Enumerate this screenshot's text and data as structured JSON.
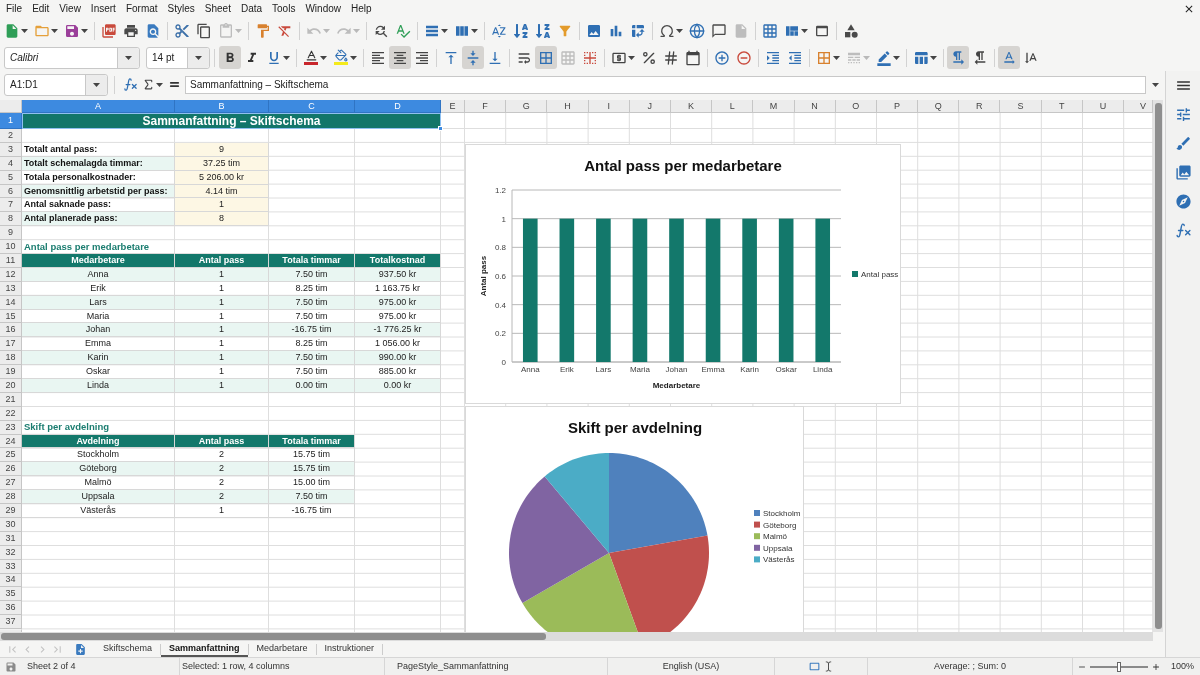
{
  "menu": [
    "File",
    "Edit",
    "View",
    "Insert",
    "Format",
    "Styles",
    "Sheet",
    "Data",
    "Tools",
    "Window",
    "Help"
  ],
  "standard_toolbar": [
    [
      {
        "kind": "new",
        "disabled": false
      },
      {
        "kind": "open",
        "disabled": false
      },
      {
        "kind": "save",
        "disabled": false
      }
    ],
    [
      {
        "kind": "export_pdf",
        "disabled": false
      },
      {
        "kind": "print",
        "disabled": false
      },
      {
        "kind": "print_preview",
        "disabled": false
      }
    ],
    [
      {
        "kind": "cut",
        "disabled": false
      },
      {
        "kind": "copy",
        "disabled": false
      },
      {
        "kind": "paste",
        "disabled": true
      }
    ],
    [
      {
        "kind": "clone_formatting",
        "disabled": false
      },
      {
        "kind": "clear_formatting",
        "disabled": false
      }
    ],
    [
      {
        "kind": "undo",
        "disabled": true
      },
      {
        "kind": "redo",
        "disabled": true
      }
    ],
    [
      {
        "kind": "find_replace",
        "disabled": false
      },
      {
        "kind": "spelling",
        "disabled": false
      }
    ],
    [
      {
        "kind": "row",
        "disabled": false
      },
      {
        "kind": "column",
        "disabled": false
      }
    ],
    [
      {
        "kind": "sort",
        "disabled": false
      },
      {
        "kind": "sort_ascending",
        "disabled": false
      },
      {
        "kind": "sort_descending",
        "disabled": false
      },
      {
        "kind": "autofilter",
        "disabled": false
      }
    ],
    [
      {
        "kind": "image",
        "disabled": false
      },
      {
        "kind": "chart",
        "disabled": false
      },
      {
        "kind": "pivot_table",
        "disabled": false
      }
    ],
    [
      {
        "kind": "special_character",
        "disabled": false
      },
      {
        "kind": "hyperlink",
        "disabled": false
      },
      {
        "kind": "comment",
        "disabled": false
      },
      {
        "kind": "header_footer",
        "disabled": true
      }
    ],
    [
      {
        "kind": "print_area",
        "disabled": false
      },
      {
        "kind": "freeze",
        "disabled": false
      },
      {
        "kind": "split_window",
        "disabled": false
      }
    ],
    [
      {
        "kind": "draw_functions",
        "disabled": false
      }
    ]
  ],
  "format_toolbar": {
    "font": "Calibri",
    "size": "14 pt",
    "groups": [
      [
        {
          "kind": "bold",
          "on": true,
          "disabled": false
        },
        {
          "kind": "italic",
          "on": false,
          "disabled": false
        },
        {
          "kind": "underline",
          "on": false,
          "disabled": false
        }
      ],
      [
        {
          "kind": "font_color",
          "on": false,
          "disabled": false
        },
        {
          "kind": "highlight",
          "on": false,
          "disabled": false
        }
      ],
      [
        {
          "kind": "align_left",
          "on": false,
          "disabled": false
        },
        {
          "kind": "align_center",
          "on": true,
          "disabled": false
        },
        {
          "kind": "align_right",
          "on": false,
          "disabled": false
        }
      ],
      [
        {
          "kind": "align_top",
          "on": false,
          "disabled": false
        },
        {
          "kind": "align_middle",
          "on": true,
          "disabled": false
        },
        {
          "kind": "align_bottom",
          "on": false,
          "disabled": false
        }
      ],
      [
        {
          "kind": "wrap_text",
          "on": false,
          "disabled": false
        },
        {
          "kind": "merge_center",
          "on": true,
          "disabled": false
        },
        {
          "kind": "merge",
          "on": false,
          "disabled": true
        },
        {
          "kind": "unmerge",
          "on": false,
          "disabled": false
        }
      ],
      [
        {
          "kind": "currency",
          "on": false,
          "disabled": false
        },
        {
          "kind": "percent",
          "on": false,
          "disabled": false
        },
        {
          "kind": "number",
          "on": false,
          "disabled": false
        },
        {
          "kind": "date",
          "on": false,
          "disabled": false
        }
      ],
      [
        {
          "kind": "add_decimal",
          "on": false,
          "disabled": false
        },
        {
          "kind": "delete_decimal",
          "on": false,
          "disabled": false
        }
      ],
      [
        {
          "kind": "indent_increase",
          "on": false,
          "disabled": false
        },
        {
          "kind": "indent_decrease",
          "on": false,
          "disabled": false
        }
      ],
      [
        {
          "kind": "borders",
          "on": false,
          "disabled": false
        },
        {
          "kind": "border_style",
          "on": false,
          "disabled": true
        },
        {
          "kind": "border_color",
          "on": false,
          "disabled": false
        }
      ],
      [
        {
          "kind": "conditional",
          "on": false,
          "disabled": false
        }
      ],
      [
        {
          "kind": "left_to_right",
          "on": true,
          "disabled": false
        },
        {
          "kind": "right_to_left",
          "on": false,
          "disabled": false
        }
      ],
      [
        {
          "kind": "text_horizontal",
          "on": true,
          "disabled": false
        },
        {
          "kind": "text_vertical",
          "on": false,
          "disabled": false
        }
      ]
    ]
  },
  "formula_bar": {
    "name_box": "A1:D1",
    "content": "Sammanfattning – Skiftschema"
  },
  "sheet": {
    "columns": [
      {
        "label": "A",
        "selected": true
      },
      {
        "label": "B",
        "selected": true
      },
      {
        "label": "C",
        "selected": true
      },
      {
        "label": "D",
        "selected": true
      },
      {
        "label": "E",
        "selected": false
      },
      {
        "label": "F",
        "selected": false
      },
      {
        "label": "G",
        "selected": false
      },
      {
        "label": "H",
        "selected": false
      },
      {
        "label": "I",
        "selected": false
      },
      {
        "label": "J",
        "selected": false
      },
      {
        "label": "K",
        "selected": false
      },
      {
        "label": "L",
        "selected": false
      },
      {
        "label": "M",
        "selected": false
      },
      {
        "label": "N",
        "selected": false
      },
      {
        "label": "O",
        "selected": false
      },
      {
        "label": "P",
        "selected": false
      },
      {
        "label": "Q",
        "selected": false
      },
      {
        "label": "R",
        "selected": false
      },
      {
        "label": "S",
        "selected": false
      },
      {
        "label": "T",
        "selected": false
      },
      {
        "label": "U",
        "selected": false
      },
      {
        "label": "V",
        "selected": false
      }
    ],
    "rows": [
      {
        "label": "1",
        "selected": true
      },
      {
        "label": "2",
        "selected": false
      },
      {
        "label": "3",
        "selected": false
      },
      {
        "label": "4",
        "selected": false
      },
      {
        "label": "5",
        "selected": false
      },
      {
        "label": "6",
        "selected": false
      },
      {
        "label": "7",
        "selected": false
      },
      {
        "label": "8",
        "selected": false
      },
      {
        "label": "9",
        "selected": false
      },
      {
        "label": "10",
        "selected": false
      },
      {
        "label": "11",
        "selected": false
      },
      {
        "label": "12",
        "selected": false
      },
      {
        "label": "13",
        "selected": false
      },
      {
        "label": "14",
        "selected": false
      },
      {
        "label": "15",
        "selected": false
      },
      {
        "label": "16",
        "selected": false
      },
      {
        "label": "17",
        "selected": false
      },
      {
        "label": "18",
        "selected": false
      },
      {
        "label": "19",
        "selected": false
      },
      {
        "label": "20",
        "selected": false
      },
      {
        "label": "21",
        "selected": false
      },
      {
        "label": "22",
        "selected": false
      },
      {
        "label": "23",
        "selected": false
      },
      {
        "label": "24",
        "selected": false
      },
      {
        "label": "25",
        "selected": false
      },
      {
        "label": "26",
        "selected": false
      },
      {
        "label": "27",
        "selected": false
      },
      {
        "label": "28",
        "selected": false
      },
      {
        "label": "29",
        "selected": false
      },
      {
        "label": "30",
        "selected": false
      },
      {
        "label": "31",
        "selected": false
      },
      {
        "label": "32",
        "selected": false
      },
      {
        "label": "33",
        "selected": false
      },
      {
        "label": "34",
        "selected": false
      },
      {
        "label": "35",
        "selected": false
      },
      {
        "label": "36",
        "selected": false
      },
      {
        "label": "37",
        "selected": false
      }
    ],
    "title": "Sammanfattning – Skiftschema",
    "stats": [
      {
        "label": "Totalt antal pass:",
        "value": "9"
      },
      {
        "label": "Totalt schemalagda timmar:",
        "value": "37.25 tim"
      },
      {
        "label": "Totala personalkostnader:",
        "value": "5 206.00 kr"
      },
      {
        "label": "Genomsnittlig arbetstid per pass:",
        "value": "4.14 tim"
      },
      {
        "label": "Antal saknade pass:",
        "value": "1"
      },
      {
        "label": "Antal planerade pass:",
        "value": "8"
      }
    ],
    "employee_table": {
      "heading": "Antal pass per medarbetare",
      "columns": [
        "Medarbetare",
        "Antal pass",
        "Totala timmar",
        "Totalkostnad"
      ],
      "rows": [
        [
          "Anna",
          "1",
          "7.50 tim",
          "937.50 kr"
        ],
        [
          "Erik",
          "1",
          "8.25 tim",
          "1 163.75 kr"
        ],
        [
          "Lars",
          "1",
          "7.50 tim",
          "975.00 kr"
        ],
        [
          "Maria",
          "1",
          "7.50 tim",
          "975.00 kr"
        ],
        [
          "Johan",
          "1",
          "-16.75 tim",
          "-1 776.25 kr"
        ],
        [
          "Emma",
          "1",
          "8.25 tim",
          "1 056.00 kr"
        ],
        [
          "Karin",
          "1",
          "7.50 tim",
          "990.00 kr"
        ],
        [
          "Oskar",
          "1",
          "7.50 tim",
          "885.00 kr"
        ],
        [
          "Linda",
          "1",
          "0.00 tim",
          "0.00 kr"
        ]
      ]
    },
    "department_table": {
      "heading": "Skift per avdelning",
      "columns": [
        "Avdelning",
        "Antal pass",
        "Totala timmar"
      ],
      "rows": [
        [
          "Stockholm",
          "2",
          "15.75 tim"
        ],
        [
          "Göteborg",
          "2",
          "15.75 tim"
        ],
        [
          "Malmö",
          "2",
          "15.00 tim"
        ],
        [
          "Uppsala",
          "2",
          "7.50 tim"
        ],
        [
          "Västerås",
          "1",
          "-16.75 tim"
        ]
      ]
    },
    "charts": [
      {
        "chart_data": {
          "type": "bar",
          "title": "Antal pass per medarbetare",
          "xlabel": "Medarbetare",
          "ylabel": "Antal pass",
          "categories": [
            "Anna",
            "Erik",
            "Lars",
            "Maria",
            "Johan",
            "Emma",
            "Karin",
            "Oskar",
            "Linda"
          ],
          "series": [
            {
              "name": "Antal pass",
              "color": "#13786b",
              "values": [
                1,
                1,
                1,
                1,
                1,
                1,
                1,
                1,
                1
              ]
            }
          ],
          "ylim": [
            0,
            1.2
          ],
          "yticks": [
            0,
            0.2,
            0.4,
            0.6,
            0.8,
            1,
            1.2
          ],
          "grid": true,
          "legend": "right"
        }
      },
      {
        "chart_data": {
          "type": "pie",
          "title": "Skift per avdelning",
          "categories": [
            "Stockholm",
            "Göteborg",
            "Malmö",
            "Uppsala",
            "Västerås"
          ],
          "values": [
            22.22,
            22.22,
            22.22,
            22.22,
            11.12
          ],
          "colors": [
            "#4f81bd",
            "#c0504d",
            "#9bbb59",
            "#8064a2",
            "#4bacc6"
          ],
          "legend": "right"
        }
      }
    ]
  },
  "sheet_nav": [
    {
      "kind": "first",
      "disabled": true
    },
    {
      "kind": "previous",
      "disabled": true
    },
    {
      "kind": "next",
      "disabled": true
    },
    {
      "kind": "last",
      "disabled": true
    }
  ],
  "sheet_tabs": [
    {
      "label": "Skiftschema",
      "selected": false
    },
    {
      "label": "Sammanfattning",
      "selected": true
    },
    {
      "label": "Medarbetare",
      "selected": false
    },
    {
      "label": "Instruktioner",
      "selected": false
    }
  ],
  "status_bar": {
    "sheet": "Sheet 2 of 4",
    "selection": "Selected: 1 row, 4 columns",
    "page_style": "PageStyle_Sammanfattning",
    "language": "English (USA)",
    "summary": "Average: ; Sum: 0",
    "zoom": {
      "level": 0.5,
      "reading": "100%"
    }
  }
}
